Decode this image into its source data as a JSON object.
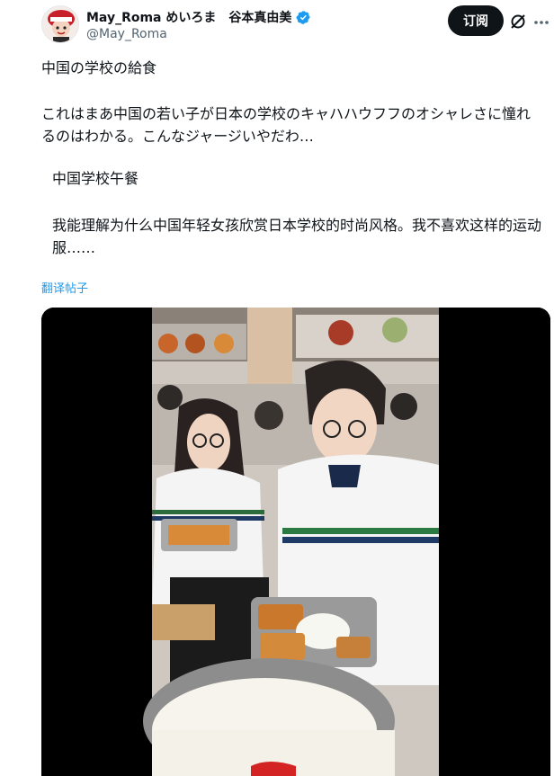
{
  "post": {
    "author_name": "May_Roma めいろま　谷本真由美",
    "author_handle": "@May_Roma",
    "subscribe_label": "订阅",
    "title_line": "中国の学校の給食",
    "body_text": "これはまあ中国の若い子が日本の学校のキャハハウフフのオシャレさに憧れるのはわかる。こんなジャージいやだわ…",
    "translated_title": "中国学校午餐",
    "translated_body": "我能理解为什么中国年轻女孩欣赏日本学校的时尚风格。我不喜欢这样的运动服……",
    "translate_link": "翻译帖子"
  },
  "icons": {
    "verified": "verified-badge-icon",
    "grok": "grok-icon",
    "more": "more-icon"
  },
  "colors": {
    "accent": "#1d9bf0",
    "text": "#0f1419",
    "muted": "#536471",
    "button": "#0f1419"
  }
}
